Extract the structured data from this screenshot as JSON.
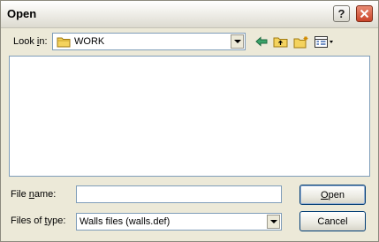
{
  "window": {
    "title": "Open"
  },
  "titlebar": {
    "help_glyph": "?",
    "close_glyph": "✕"
  },
  "lookin": {
    "label_prefix": "Look ",
    "label_accel": "i",
    "label_suffix": "n:",
    "value": "WORK"
  },
  "toolbar": {
    "icons": [
      "back-arrow-icon",
      "up-folder-icon",
      "new-folder-icon",
      "views-menu-icon"
    ]
  },
  "filename": {
    "label_prefix": "File ",
    "label_accel": "n",
    "label_suffix": "ame:",
    "value": ""
  },
  "filetype": {
    "label_prefix": "Files of ",
    "label_accel": "t",
    "label_suffix": "ype:",
    "value": "Walls files (walls.def)"
  },
  "buttons": {
    "open_accel": "O",
    "open_suffix": "pen",
    "cancel_label": "Cancel"
  },
  "colors": {
    "dialog_bg": "#ece9d8",
    "field_border": "#7f9db9",
    "folder_yellow": "#f4d35e",
    "close_red": "#d9532f"
  }
}
